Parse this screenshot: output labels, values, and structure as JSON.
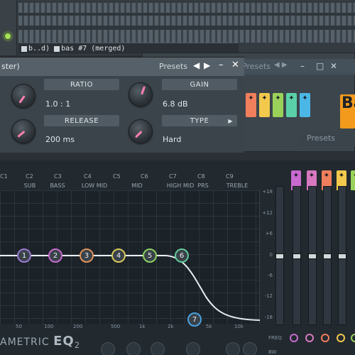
{
  "top": {
    "clip_label_1": "b..d)",
    "clip_label_2": "bas #7 (merged)"
  },
  "background_window": {
    "presets_label": "Presets",
    "minimize": "–",
    "maximize": "□",
    "close": "✕",
    "big_letter": "Ba",
    "presets2_label": "Presets"
  },
  "compressor": {
    "title": "ster)",
    "presets_label": "Presets",
    "prev_arrow": "◀",
    "next_arrow": "▶",
    "minimize": "–",
    "maximize": "□",
    "close": "✕",
    "ratio": {
      "label": "RATIO",
      "value": "1.0 : 1"
    },
    "gain": {
      "label": "GAIN",
      "value": "6.8 dB"
    },
    "release": {
      "label": "RELEASE",
      "value": "200 ms"
    },
    "type": {
      "label": "TYPE",
      "value": "Hard",
      "arrow": "▶"
    }
  },
  "eq": {
    "logo_text": "AMETRIC",
    "logo_bold": "EQ",
    "logo_sub": "2",
    "band_tops": [
      "C1",
      "C2",
      "C3",
      "C4",
      "C5",
      "C6",
      "C7",
      "C8",
      "C9"
    ],
    "band_names": [
      "SUB",
      "BASS",
      "LOW MID",
      "MID",
      "HIGH MID",
      "PRS",
      "TREBLE"
    ],
    "freq_ticks": [
      "50",
      "100",
      "200",
      "500",
      "1k",
      "2k",
      "5k",
      "10k"
    ],
    "db_ticks": [
      "+18",
      "+12",
      "+6",
      "0",
      "-6",
      "-12",
      "-18"
    ],
    "nodes": [
      "1",
      "2",
      "3",
      "4",
      "5",
      "6",
      "7"
    ],
    "freq_label": "FREQ",
    "bw_label": "BW",
    "colors": {
      "node1": "#9a7ad6",
      "node2": "#c86ad0",
      "node3": "#e0925a",
      "node4": "#d8c85a",
      "node5": "#8ad060",
      "node6": "#60c89a",
      "node7": "#4aa0e0",
      "accent_pink": "#ff80b0"
    }
  }
}
